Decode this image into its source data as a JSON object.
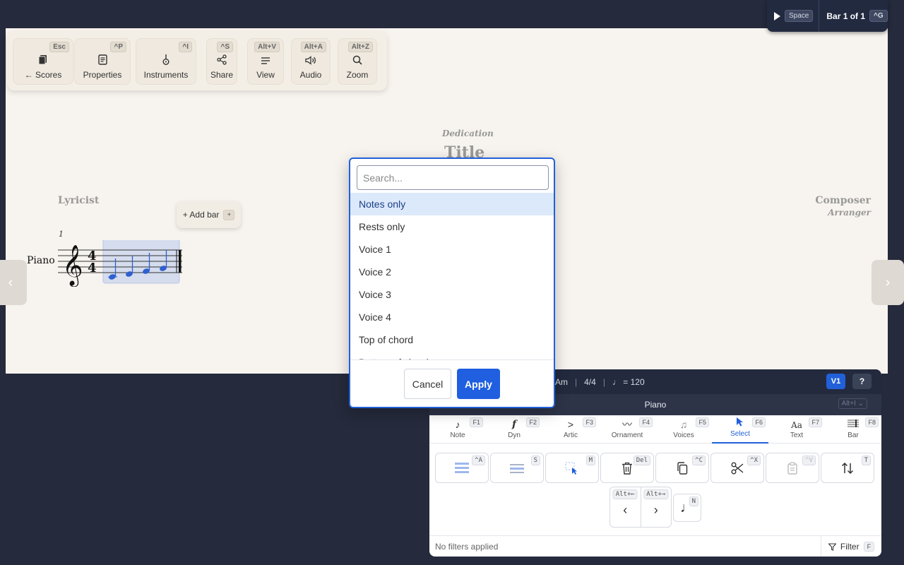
{
  "playback": {
    "play_key": "Space",
    "bar_text": "Bar 1 of 1",
    "bar_key": "^G"
  },
  "toolbar": {
    "items": [
      {
        "label": "← Scores",
        "key": "Esc",
        "icon": "scores-icon"
      },
      {
        "label": "Properties",
        "key": "^P",
        "icon": "properties-icon"
      },
      {
        "label": "Instruments",
        "key": "^I",
        "icon": "instruments-icon"
      },
      {
        "label": "Share",
        "key": "^S",
        "icon": "share-icon"
      },
      {
        "label": "View",
        "key": "Alt+V",
        "icon": "view-icon"
      },
      {
        "label": "Audio",
        "key": "Alt+A",
        "icon": "audio-icon"
      },
      {
        "label": "Zoom",
        "key": "Alt+Z",
        "icon": "zoom-icon"
      }
    ]
  },
  "score": {
    "dedication": "Dedication",
    "title": "Title",
    "lyricist": "Lyricist",
    "composer": "Composer",
    "arranger": "Arranger",
    "instrument": "Piano",
    "bar_number": "1",
    "add_bar_label": "+ Add bar",
    "add_bar_key": "+",
    "time_signature": "4/4"
  },
  "dialog": {
    "search_placeholder": "Search...",
    "options": [
      "Notes only",
      "Rests only",
      "Voice 1",
      "Voice 2",
      "Voice 3",
      "Voice 4",
      "Top of chord",
      "Bottom of chord"
    ],
    "selected_index": 0,
    "cancel_label": "Cancel",
    "apply_label": "Apply"
  },
  "panel": {
    "status": {
      "key": "Am",
      "time": "4/4",
      "tempo": "♩ = 120",
      "voice": "V1",
      "help": "?"
    },
    "instrument": "Piano",
    "instrument_key": "Alt+I",
    "tabs": [
      {
        "label": "Note",
        "key": "F1"
      },
      {
        "label": "Dyn",
        "key": "F2"
      },
      {
        "label": "Artic",
        "key": "F3"
      },
      {
        "label": "Ornament",
        "key": "F4"
      },
      {
        "label": "Voices",
        "key": "F5"
      },
      {
        "label": "Select",
        "key": "F6"
      },
      {
        "label": "Text",
        "key": "F7"
      },
      {
        "label": "Bar",
        "key": "F8"
      }
    ],
    "active_tab": "Select",
    "tools": [
      {
        "name": "select-all",
        "key": "^A"
      },
      {
        "name": "select-staff",
        "key": "S"
      },
      {
        "name": "select-mode",
        "key": "M"
      },
      {
        "name": "delete",
        "key": "Del"
      },
      {
        "name": "copy",
        "key": "^C"
      },
      {
        "name": "cut",
        "key": "^X"
      },
      {
        "name": "paste",
        "key": "^V"
      },
      {
        "name": "swap",
        "key": "T"
      }
    ],
    "nav_prev_key": "Alt+←",
    "nav_next_key": "Alt+→",
    "note_key": "N",
    "footer_text": "No filters applied",
    "filter_label": "Filter",
    "filter_key": "F"
  },
  "colors": {
    "accent": "#2160d8",
    "selection": "#dce9fb",
    "canvas": "#f7f3ee",
    "background": "#252a3c"
  }
}
